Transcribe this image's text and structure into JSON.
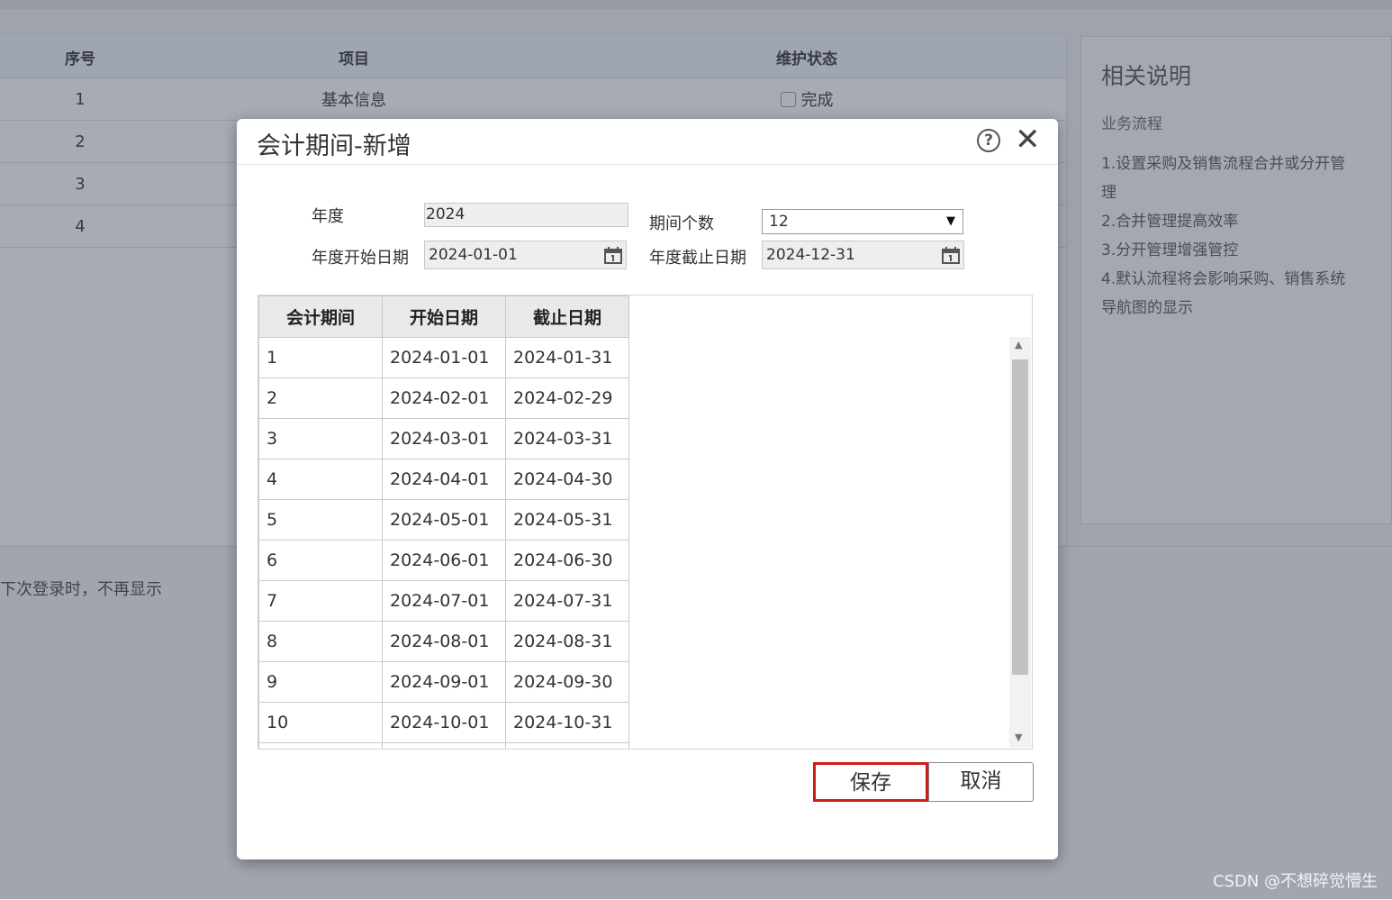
{
  "background": {
    "table": {
      "headers": [
        "序号",
        "项目",
        "维护状态"
      ],
      "rows": [
        {
          "no": "1",
          "item": "基本信息",
          "status": "完成"
        },
        {
          "no": "2",
          "item": "",
          "status": ""
        },
        {
          "no": "3",
          "item": "",
          "status": ""
        },
        {
          "no": "4",
          "item": "",
          "status": ""
        }
      ]
    },
    "remember_text": "下次登录时，不再显示",
    "right_panel": {
      "title": "相关说明",
      "subtitle": "业务流程",
      "items": [
        "1.设置采购及销售流程合并或分开管",
        "理",
        "2.合并管理提高效率",
        "3.分开管理增强管控",
        "4.默认流程将会影响采购、销售系统",
        "导航图的显示"
      ]
    }
  },
  "dialog": {
    "title": "会计期间-新增",
    "help_icon": "?",
    "close_icon": "✕",
    "form": {
      "year_label": "年度",
      "year_value": "2024",
      "start_label": "年度开始日期",
      "start_value": "2024-01-01",
      "end_label": "年度截止日期",
      "end_value": "2024-12-31",
      "period_count_label": "期间个数",
      "period_count_value": "12"
    },
    "grid": {
      "headers": [
        "会计期间",
        "开始日期",
        "截止日期"
      ],
      "rows": [
        [
          "1",
          "2024-01-01",
          "2024-01-31"
        ],
        [
          "2",
          "2024-02-01",
          "2024-02-29"
        ],
        [
          "3",
          "2024-03-01",
          "2024-03-31"
        ],
        [
          "4",
          "2024-04-01",
          "2024-04-30"
        ],
        [
          "5",
          "2024-05-01",
          "2024-05-31"
        ],
        [
          "6",
          "2024-06-01",
          "2024-06-30"
        ],
        [
          "7",
          "2024-07-01",
          "2024-07-31"
        ],
        [
          "8",
          "2024-08-01",
          "2024-08-31"
        ],
        [
          "9",
          "2024-09-01",
          "2024-09-30"
        ],
        [
          "10",
          "2024-10-01",
          "2024-10-31"
        ]
      ]
    },
    "buttons": {
      "save": "保存",
      "cancel": "取消"
    }
  },
  "watermark": "CSDN @不想碎觉懵生",
  "colors": {
    "save_highlight": "#d11a1a",
    "overlay": "#3c4458"
  }
}
